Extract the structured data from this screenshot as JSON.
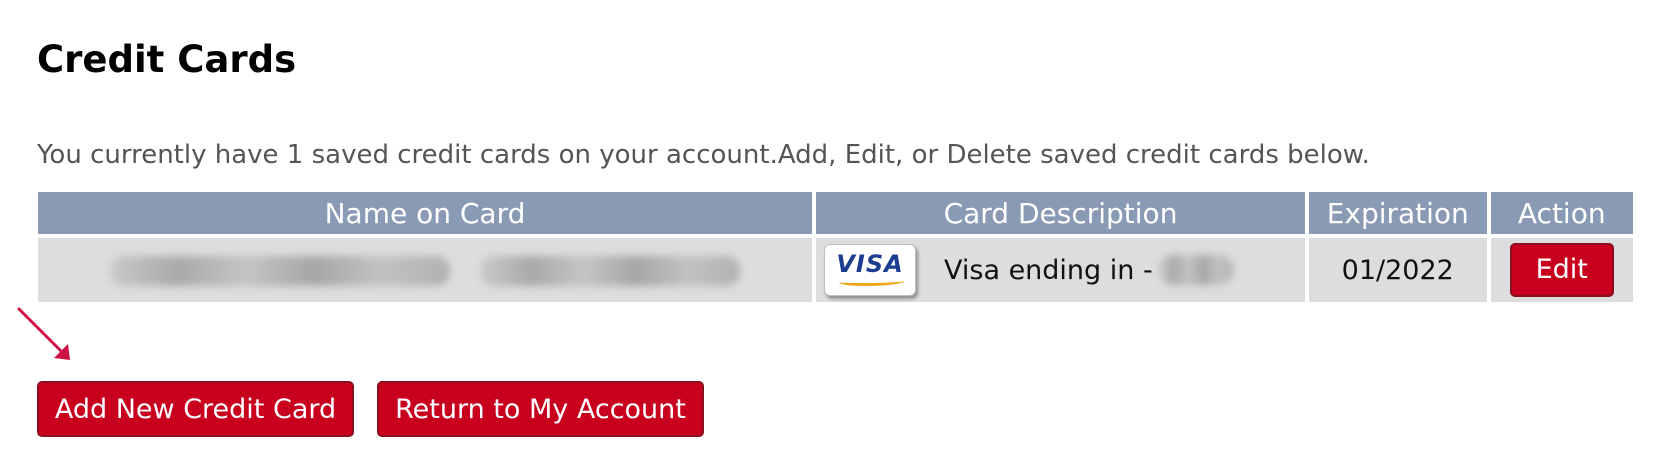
{
  "page": {
    "title": "Credit Cards",
    "intro": "You currently have 1 saved credit cards on your account.Add, Edit, or Delete saved credit cards below."
  },
  "table": {
    "headers": [
      "Name on Card",
      "Card Description",
      "Expiration",
      "Action"
    ],
    "rows": [
      {
        "name_on_card": "",
        "card_brand_icon": "visa-logo-icon",
        "card_brand_text": "VISA",
        "description": "Visa ending in -",
        "last_digits": "",
        "expiration": "01/2022",
        "action_label": "Edit"
      }
    ]
  },
  "buttons": {
    "add_new": "Add New Credit Card",
    "return": "Return to My Account"
  },
  "annotations": {
    "arrow_icon": "arrow-down-right-icon",
    "arrow_color": "#cc1144"
  },
  "colors": {
    "header_bg": "#8a9ab5",
    "row_bg": "#dddddd",
    "button_bg": "#c8001e",
    "visa_blue": "#1a3d8f",
    "visa_gold": "#f2a516"
  }
}
